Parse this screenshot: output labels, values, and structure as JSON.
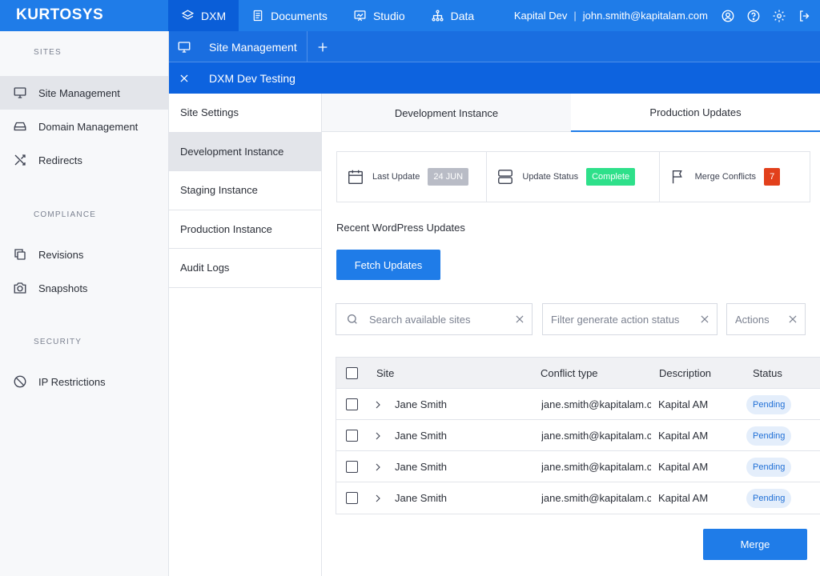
{
  "app": {
    "logo": "KURTOSYS"
  },
  "topnav": {
    "items": [
      {
        "label": "DXM",
        "icon": "layers-icon"
      },
      {
        "label": "Documents",
        "icon": "documents-icon"
      },
      {
        "label": "Studio",
        "icon": "studio-icon"
      },
      {
        "label": "Data",
        "icon": "data-icon"
      }
    ],
    "workspace": "Kapital Dev",
    "separator": "|",
    "email": "john.smith@kapitalam.com"
  },
  "sidebar": {
    "sections": [
      "SITES",
      "COMPLIANCE",
      "SECURITY"
    ],
    "items": [
      {
        "label": "Site Management",
        "icon": "monitor-icon"
      },
      {
        "label": "Domain Management",
        "icon": "drive-icon"
      },
      {
        "label": "Redirects",
        "icon": "shuffle-icon"
      },
      {
        "label": "Revisions",
        "icon": "copy-icon"
      },
      {
        "label": "Snapshots",
        "icon": "camera-icon"
      },
      {
        "label": "IP Restrictions",
        "icon": "ban-icon"
      }
    ]
  },
  "tabs": {
    "site_management": "Site Management",
    "dxm_dev_testing": "DXM Dev Testing"
  },
  "col2": {
    "items": [
      "Site Settings",
      "Development Instance",
      "Staging Instance",
      "Production Instance",
      "Audit Logs"
    ]
  },
  "main": {
    "subtabs": [
      "Development Instance",
      "Production Updates"
    ],
    "cards": {
      "last_update_label": "Last Update",
      "last_update_value": "24 JUN",
      "status_label": "Update Status",
      "status_value": "Complete",
      "conflicts_label": "Merge Conflicts",
      "conflicts_value": "7"
    },
    "recent_title": "Recent WordPress Updates",
    "fetch_button": "Fetch Updates",
    "filters": {
      "search_placeholder": "Search available sites",
      "status_placeholder": "Filter generate action status",
      "actions_placeholder": "Actions"
    },
    "table": {
      "headers": [
        "Site",
        "Conflict type",
        "Description",
        "Status"
      ],
      "rows": [
        {
          "site": "Jane Smith",
          "conflict": "jane.smith@kapitalam.c",
          "description": "Kapital AM",
          "status": "Pending"
        },
        {
          "site": "Jane Smith",
          "conflict": "jane.smith@kapitalam.c",
          "description": "Kapital AM",
          "status": "Pending"
        },
        {
          "site": "Jane Smith",
          "conflict": "jane.smith@kapitalam.c",
          "description": "Kapital AM",
          "status": "Pending"
        },
        {
          "site": "Jane Smith",
          "conflict": "jane.smith@kapitalam.c",
          "description": "Kapital AM",
          "status": "Pending"
        }
      ]
    },
    "merge_button": "Merge"
  },
  "colors": {
    "primary": "#1f7ce8",
    "success": "#2ee08a",
    "danger": "#e2401c",
    "muted_badge": "#b9bcc6"
  }
}
